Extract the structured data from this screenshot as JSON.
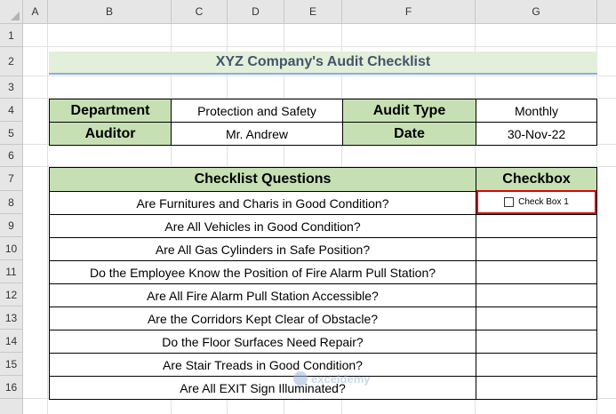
{
  "columns": [
    "A",
    "B",
    "C",
    "D",
    "E",
    "F",
    "G"
  ],
  "rows": [
    "1",
    "2",
    "3",
    "4",
    "5",
    "6",
    "7",
    "8",
    "9",
    "10",
    "11",
    "12",
    "13",
    "14",
    "15",
    "16"
  ],
  "title": "XYZ Company's Audit Checklist",
  "info": {
    "department_label": "Department",
    "department_value": "Protection and Safety",
    "audit_type_label": "Audit Type",
    "audit_type_value": "Monthly",
    "auditor_label": "Auditor",
    "auditor_value": "Mr. Andrew",
    "date_label": "Date",
    "date_value": "30-Nov-22"
  },
  "table": {
    "questions_header": "Checklist Questions",
    "checkbox_header": "Checkbox",
    "questions": [
      "Are Furnitures and Charis in Good Condition?",
      "Are All Vehicles in Good Condition?",
      "Are All Gas Cylinders in Safe Position?",
      "Do the Employee Know the Position of Fire Alarm Pull Station?",
      "Are All Fire Alarm Pull Station Accessible?",
      "Are the Corridors Kept Clear of Obstacle?",
      "Do the Floor Surfaces Need Repair?",
      "Are Stair Treads in Good Condition?",
      "Are All EXIT Sign Illuminated?"
    ],
    "checkbox_label": "Check Box 1"
  },
  "watermark": "exceldemy"
}
